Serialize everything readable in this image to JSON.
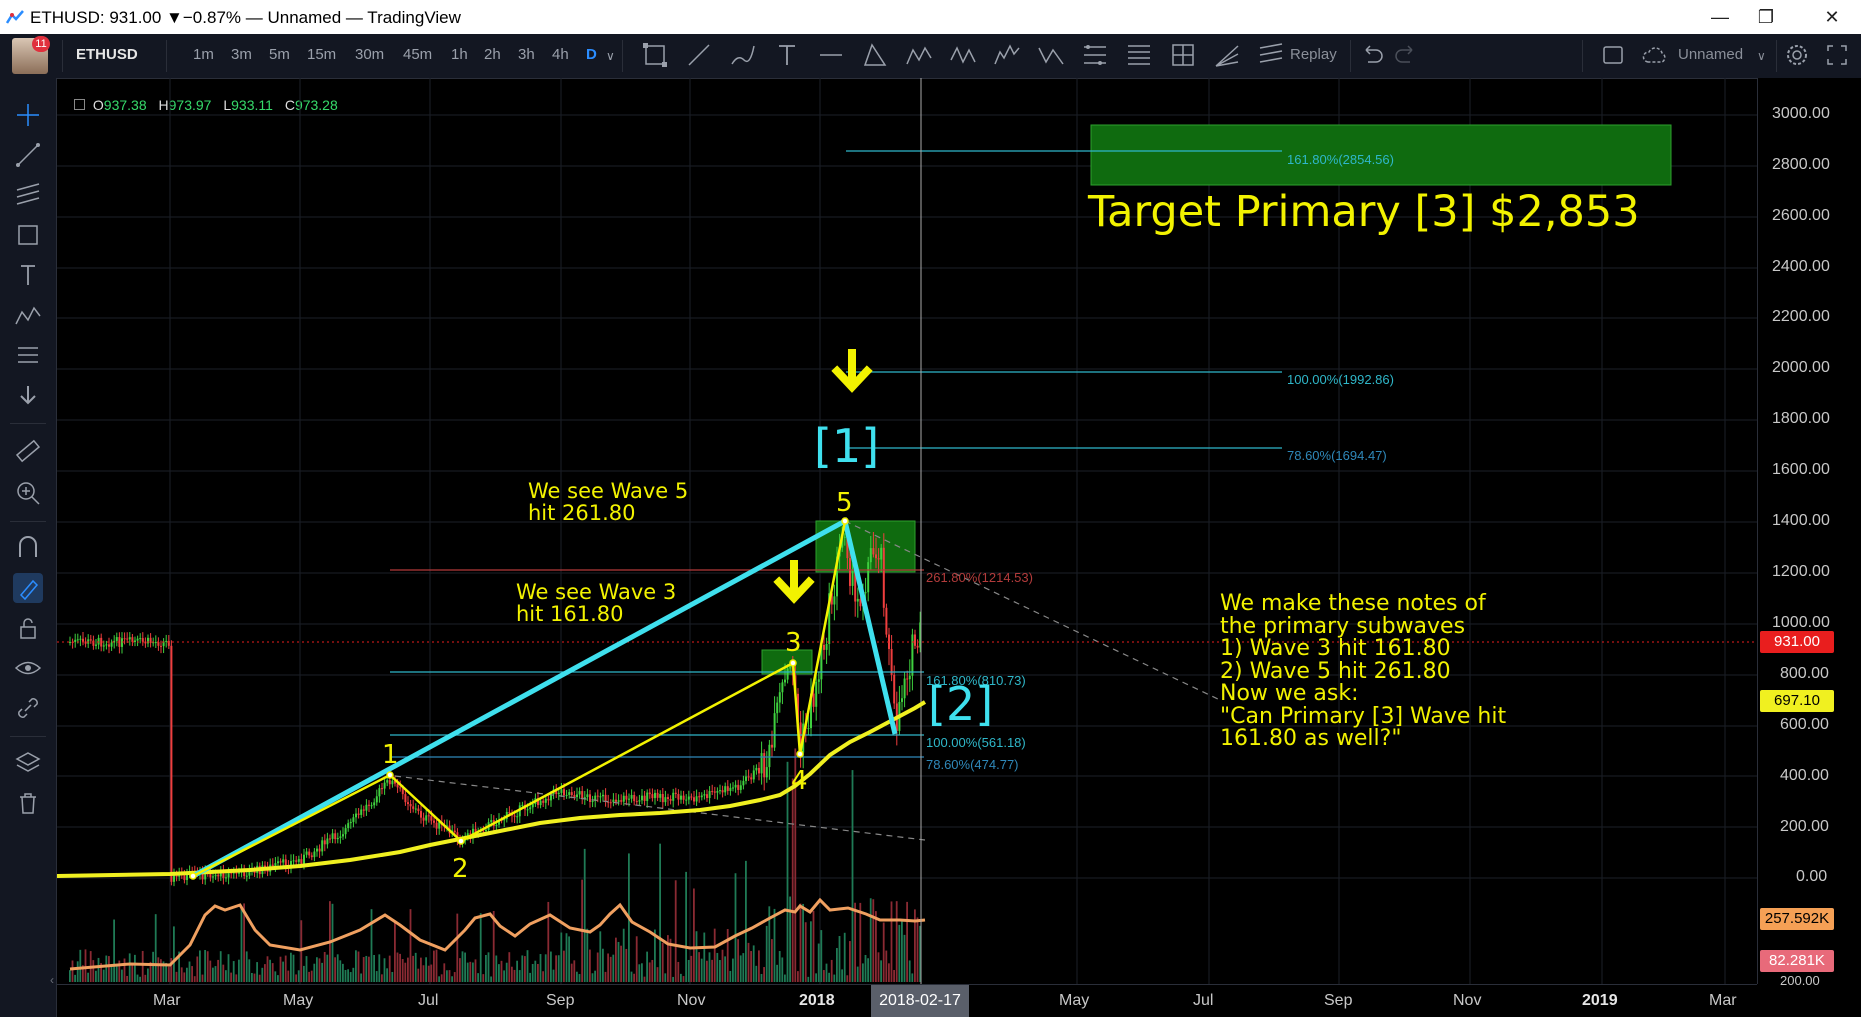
{
  "window": {
    "title": "ETHUSD: 931.00 ▼−0.87% — Unnamed — TradingView",
    "minimize": "—",
    "restore": "❐",
    "close": "✕"
  },
  "toolbar": {
    "notification_count": "11",
    "symbol": "ETHUSD",
    "timeframes": [
      "1m",
      "3m",
      "5m",
      "15m",
      "30m",
      "45m",
      "1h",
      "2h",
      "3h",
      "4h",
      "D"
    ],
    "active_timeframe": "D",
    "replay": "Replay",
    "layout_name": "Unnamed"
  },
  "ohlc": {
    "o_label": "O",
    "o": "937.38",
    "h_label": "H",
    "h": "973.97",
    "l_label": "L",
    "l": "933.11",
    "c_label": "C",
    "c": "973.28"
  },
  "price_axis": {
    "ticks": [
      "3000.00",
      "2800.00",
      "2600.00",
      "2400.00",
      "2200.00",
      "2000.00",
      "1800.00",
      "1600.00",
      "1400.00",
      "1200.00",
      "1000.00",
      "800.00",
      "600.00",
      "400.00",
      "200.00",
      "0.00"
    ],
    "last_price": "931.00",
    "ma_price": "697.10",
    "vol_ma": "257.592K",
    "volume": "82.281K",
    "volume_tick": "200.00"
  },
  "time_axis": {
    "ticks": [
      "Mar",
      "May",
      "Jul",
      "Sep",
      "Nov",
      "2018",
      "May",
      "Jul",
      "Sep",
      "Nov",
      "2019",
      "Mar"
    ],
    "crosshair_date": "2018-02-17"
  },
  "fib_levels": {
    "l1618_top": "161.80%(2854.56)",
    "l100_top": "100.00%(1992.86)",
    "l786_top": "78.60%(1694.47)",
    "l2618": "261.80%(1214.53)",
    "l1618": "161.80%(810.73)",
    "l100": "100.00%(561.18)",
    "l786": "78.60%(474.77)"
  },
  "annotations": {
    "target": "Target Primary [3] $2,853",
    "wave5_note_line1": "We see Wave 5",
    "wave5_note_line2": "hit 261.80",
    "wave3_note_line1": "We see Wave 3",
    "wave3_note_line2": "hit 161.80",
    "primary1": "[1]",
    "primary2": "[2]",
    "w1": "1",
    "w2": "2",
    "w3": "3",
    "w4": "4",
    "w5": "5",
    "notes": [
      "We make these notes of",
      "the primary subwaves",
      "1) Wave 3 hit 161.80",
      "2) Wave 5 hit 261.80",
      "Now we ask:",
      "\"Can Primary [3] Wave hit",
      "161.80 as well?\""
    ]
  },
  "colors": {
    "candle_up": "#26a69a",
    "candle_up_bright": "#3fd13f",
    "candle_down": "#ef3e3e",
    "fib": "#2fb7c9",
    "fib_red": "#b23b3b",
    "annotation": "#f2f200",
    "wave_cyan": "#3fe0ee",
    "ma": "#f0f020",
    "vol_ma": "#f0a060",
    "last_price_tag": "#e91e1e",
    "ma_tag": "#f0f020",
    "vol_tag": "#f5a055",
    "volume_tag": "#e86a7a"
  }
}
